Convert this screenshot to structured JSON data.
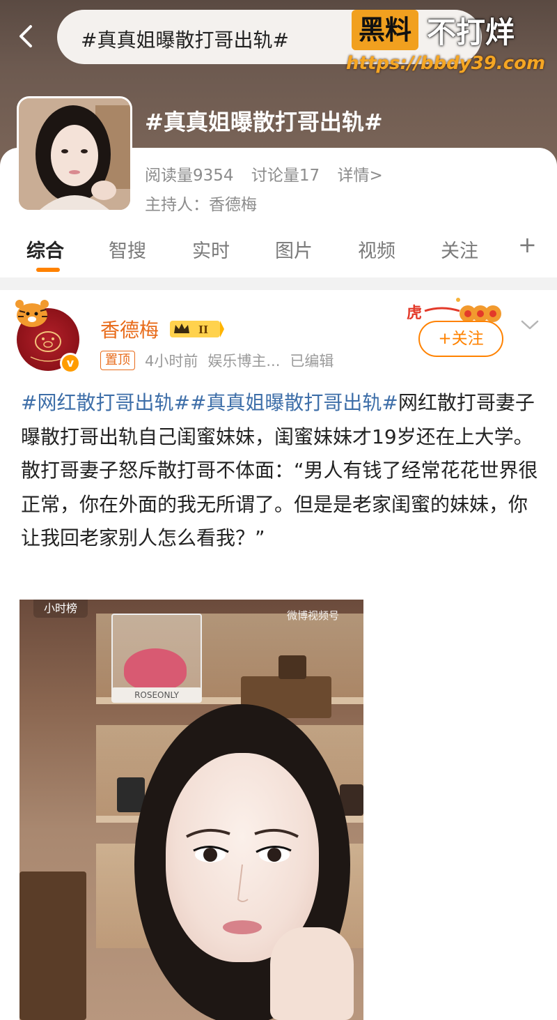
{
  "header": {
    "search_text": "#真真姐曝散打哥出轨#",
    "topic_title": "#真真姐曝散打哥出轨#"
  },
  "watermark": {
    "box_text": "黑料",
    "white_text": "不打烊",
    "url": "https://bbdy39.com"
  },
  "topic": {
    "reads": "阅读量9354",
    "discussions": "讨论量17",
    "details": "详情>",
    "host": "主持人：香德梅"
  },
  "tabs": [
    {
      "label": "综合",
      "active": true
    },
    {
      "label": "智搜",
      "active": false
    },
    {
      "label": "实时",
      "active": false
    },
    {
      "label": "图片",
      "active": false
    },
    {
      "label": "视频",
      "active": false
    },
    {
      "label": "关注",
      "active": false
    },
    {
      "label": "+",
      "active": false
    }
  ],
  "post": {
    "author": "香德梅",
    "level": "II",
    "pinned": "置顶",
    "time": "4小时前",
    "role": "娱乐博主...",
    "edited": "已编辑",
    "follow_label": "+关注",
    "hashtag1": "#网红散打哥出轨#",
    "hashtag2": "#真真姐曝散打哥出轨#",
    "body": "网红散打哥妻子曝散打哥出轨自己闺蜜妹妹，闺蜜妹妹才19岁还在上大学。散打哥妻子怒斥散打哥不体面：“男人有钱了经常花花世界很正常，你在外面的我无所谓了。但是是老家闺蜜的妹妹，你让我回老家别人怎么看我？”",
    "image_tag": "小时榜",
    "image_brand": "微博视频号",
    "image_shelf_label": "ROSEONLY"
  },
  "colors": {
    "accent": "#ff8200",
    "author": "#e86b1a",
    "hashtag": "#3d6ea8",
    "header_bg": "#6d5a50"
  }
}
